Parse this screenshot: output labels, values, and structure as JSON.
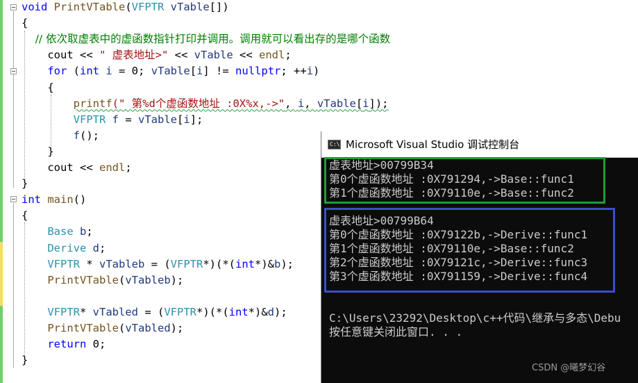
{
  "editor": {
    "lines": [
      [
        {
          "t": "void ",
          "c": "kw"
        },
        {
          "t": "PrintVTable",
          "c": "fn"
        },
        {
          "t": "(",
          "c": ""
        },
        {
          "t": "VFPTR ",
          "c": "ty"
        },
        {
          "t": "vTable",
          "c": "var"
        },
        {
          "t": "[])",
          "c": ""
        }
      ],
      [
        {
          "t": "{",
          "c": ""
        }
      ],
      [
        {
          "t": "    // 依次取虚表中的虚函数指针打印并调用。调用就可以看出存的是哪个函数",
          "c": "cmt"
        }
      ],
      [
        {
          "t": "    cout ",
          "c": ""
        },
        {
          "t": "<< ",
          "c": ""
        },
        {
          "t": "\" 虚表地址>\"",
          "c": "str"
        },
        {
          "t": " << ",
          "c": ""
        },
        {
          "t": "vTable",
          "c": "var"
        },
        {
          "t": " << ",
          "c": ""
        },
        {
          "t": "endl",
          "c": "fn"
        },
        {
          "t": ";",
          "c": ""
        }
      ],
      [
        {
          "t": "    ",
          "c": ""
        },
        {
          "t": "for",
          "c": "kw"
        },
        {
          "t": " (",
          "c": ""
        },
        {
          "t": "int",
          "c": "kw"
        },
        {
          "t": " ",
          "c": ""
        },
        {
          "t": "i",
          "c": "var"
        },
        {
          "t": " = 0; ",
          "c": ""
        },
        {
          "t": "vTable",
          "c": "var"
        },
        {
          "t": "[",
          "c": ""
        },
        {
          "t": "i",
          "c": "var"
        },
        {
          "t": "] != ",
          "c": ""
        },
        {
          "t": "nullptr",
          "c": "kw"
        },
        {
          "t": "; ++",
          "c": ""
        },
        {
          "t": "i",
          "c": "var"
        },
        {
          "t": ")",
          "c": ""
        }
      ],
      [
        {
          "t": "    {",
          "c": ""
        }
      ],
      [
        {
          "t": "        ",
          "c": ""
        },
        {
          "t": "printf",
          "c": "fn squig"
        },
        {
          "t": "(\" 第%d个虚函数地址 :0X%x,->\"",
          "c": "str squig"
        },
        {
          "t": ", ",
          "c": "squig"
        },
        {
          "t": "i",
          "c": "var squig"
        },
        {
          "t": ", ",
          "c": "squig"
        },
        {
          "t": "vTable",
          "c": "var squig"
        },
        {
          "t": "[",
          "c": "squig"
        },
        {
          "t": "i",
          "c": "var squig"
        },
        {
          "t": "]);",
          "c": "squig"
        }
      ],
      [
        {
          "t": "        ",
          "c": ""
        },
        {
          "t": "VFPTR",
          "c": "ty"
        },
        {
          "t": " ",
          "c": ""
        },
        {
          "t": "f",
          "c": "var"
        },
        {
          "t": " = ",
          "c": ""
        },
        {
          "t": "vTable",
          "c": "var"
        },
        {
          "t": "[",
          "c": ""
        },
        {
          "t": "i",
          "c": "var"
        },
        {
          "t": "];",
          "c": ""
        }
      ],
      [
        {
          "t": "        ",
          "c": ""
        },
        {
          "t": "f",
          "c": "var"
        },
        {
          "t": "();",
          "c": ""
        }
      ],
      [
        {
          "t": "    }",
          "c": ""
        }
      ],
      [
        {
          "t": "    cout ",
          "c": ""
        },
        {
          "t": "<< ",
          "c": ""
        },
        {
          "t": "endl",
          "c": "fn"
        },
        {
          "t": ";",
          "c": ""
        }
      ],
      [
        {
          "t": "}",
          "c": ""
        }
      ],
      [
        {
          "t": "int",
          "c": "kw"
        },
        {
          "t": " ",
          "c": ""
        },
        {
          "t": "main",
          "c": "fn"
        },
        {
          "t": "()",
          "c": ""
        }
      ],
      [
        {
          "t": "{",
          "c": ""
        }
      ],
      [
        {
          "t": "    ",
          "c": ""
        },
        {
          "t": "Base",
          "c": "ty"
        },
        {
          "t": " ",
          "c": ""
        },
        {
          "t": "b",
          "c": "var"
        },
        {
          "t": ";",
          "c": ""
        }
      ],
      [
        {
          "t": "    ",
          "c": ""
        },
        {
          "t": "Derive",
          "c": "ty"
        },
        {
          "t": " ",
          "c": ""
        },
        {
          "t": "d",
          "c": "var"
        },
        {
          "t": ";",
          "c": ""
        }
      ],
      [
        {
          "t": "    ",
          "c": ""
        },
        {
          "t": "VFPTR",
          "c": "ty"
        },
        {
          "t": " * ",
          "c": ""
        },
        {
          "t": "vTableb",
          "c": "var"
        },
        {
          "t": " = (",
          "c": ""
        },
        {
          "t": "VFPTR",
          "c": "ty"
        },
        {
          "t": "*)(*(",
          "c": ""
        },
        {
          "t": "int",
          "c": "kw"
        },
        {
          "t": "*)&",
          "c": ""
        },
        {
          "t": "b",
          "c": "var"
        },
        {
          "t": ");",
          "c": ""
        }
      ],
      [
        {
          "t": "    ",
          "c": ""
        },
        {
          "t": "PrintVTable",
          "c": "fn"
        },
        {
          "t": "(",
          "c": ""
        },
        {
          "t": "vTableb",
          "c": "var"
        },
        {
          "t": ");",
          "c": ""
        }
      ],
      [
        {
          "t": "",
          "c": ""
        }
      ],
      [
        {
          "t": "    ",
          "c": ""
        },
        {
          "t": "VFPTR",
          "c": "ty"
        },
        {
          "t": "* ",
          "c": ""
        },
        {
          "t": "vTabled",
          "c": "var"
        },
        {
          "t": " = (",
          "c": ""
        },
        {
          "t": "VFPTR",
          "c": "ty"
        },
        {
          "t": "*)(*(",
          "c": ""
        },
        {
          "t": "int",
          "c": "kw"
        },
        {
          "t": "*)&",
          "c": ""
        },
        {
          "t": "d",
          "c": "var"
        },
        {
          "t": ");",
          "c": ""
        }
      ],
      [
        {
          "t": "    ",
          "c": ""
        },
        {
          "t": "PrintVTable",
          "c": "fn"
        },
        {
          "t": "(",
          "c": ""
        },
        {
          "t": "vTabled",
          "c": "var"
        },
        {
          "t": ");",
          "c": ""
        }
      ],
      [
        {
          "t": "    ",
          "c": ""
        },
        {
          "t": "return",
          "c": "kw"
        },
        {
          "t": " 0;",
          "c": ""
        }
      ],
      [
        {
          "t": "}",
          "c": ""
        }
      ]
    ]
  },
  "console": {
    "icon_text": "C:\\",
    "title": "Microsoft Visual Studio 调试控制台",
    "output_lines": [
      "虚表地址>00799B34",
      "第0个虚函数地址 :0X791294,->Base::func1",
      "第1个虚函数地址 :0X79110e,->Base::func2",
      "",
      "虚表地址>00799B64",
      "第0个虚函数地址 :0X79122b,->Derive::func1",
      "第1个虚函数地址 :0X79110e,->Base::func2",
      "第2个虚函数地址 :0X79121c,->Derive::func3",
      "第3个虚函数地址 :0X791159,->Derive::func4",
      "",
      "",
      "C:\\Users\\23292\\Desktop\\c++代码\\继承与多态\\Debu",
      "按任意键关闭此窗口. . ."
    ],
    "watermark": "CSDN @曦梦幻谷"
  },
  "colors": {
    "keyword": "#0000ff",
    "function": "#74531f",
    "type": "#2b91af",
    "variable": "#1f377f",
    "string": "#a31515",
    "comment": "#008000",
    "console_bg": "#0c0c0c",
    "box_green": "#1e9d38",
    "box_blue": "#3b4fc9"
  }
}
